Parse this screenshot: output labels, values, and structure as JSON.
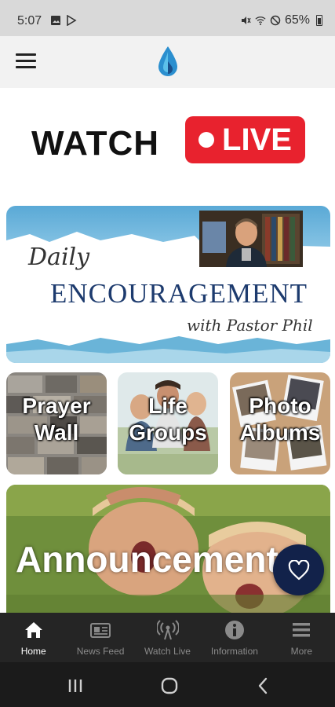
{
  "status_bar": {
    "time": "5:07",
    "battery": "65%"
  },
  "header": {
    "menu_icon": "hamburger-menu-icon",
    "logo_icon": "water-drop-logo-icon"
  },
  "watch_live": {
    "watch_label": "WATCH",
    "live_label": "LIVE",
    "live_color": "#e8222e"
  },
  "banner": {
    "script_text": "Daily",
    "title": "ENCOURAGEMENT",
    "subtitle": "with Pastor Phil"
  },
  "tiles": [
    {
      "line1": "Prayer",
      "line2": "Wall"
    },
    {
      "line1": "Life",
      "line2": "Groups"
    },
    {
      "line1": "Photo",
      "line2": "Albums"
    }
  ],
  "announcement": {
    "label": "Announcements"
  },
  "fab": {
    "icon": "heart-icon",
    "color": "#12224a"
  },
  "bottom_nav": {
    "items": [
      {
        "label": "Home",
        "icon": "home-icon",
        "active": true
      },
      {
        "label": "News Feed",
        "icon": "news-feed-icon",
        "active": false
      },
      {
        "label": "Watch Live",
        "icon": "broadcast-icon",
        "active": false
      },
      {
        "label": "Information",
        "icon": "info-icon",
        "active": false
      },
      {
        "label": "More",
        "icon": "more-menu-icon",
        "active": false
      }
    ]
  },
  "system_nav": {
    "buttons": [
      "recents-icon",
      "home-circle-icon",
      "back-icon"
    ]
  }
}
